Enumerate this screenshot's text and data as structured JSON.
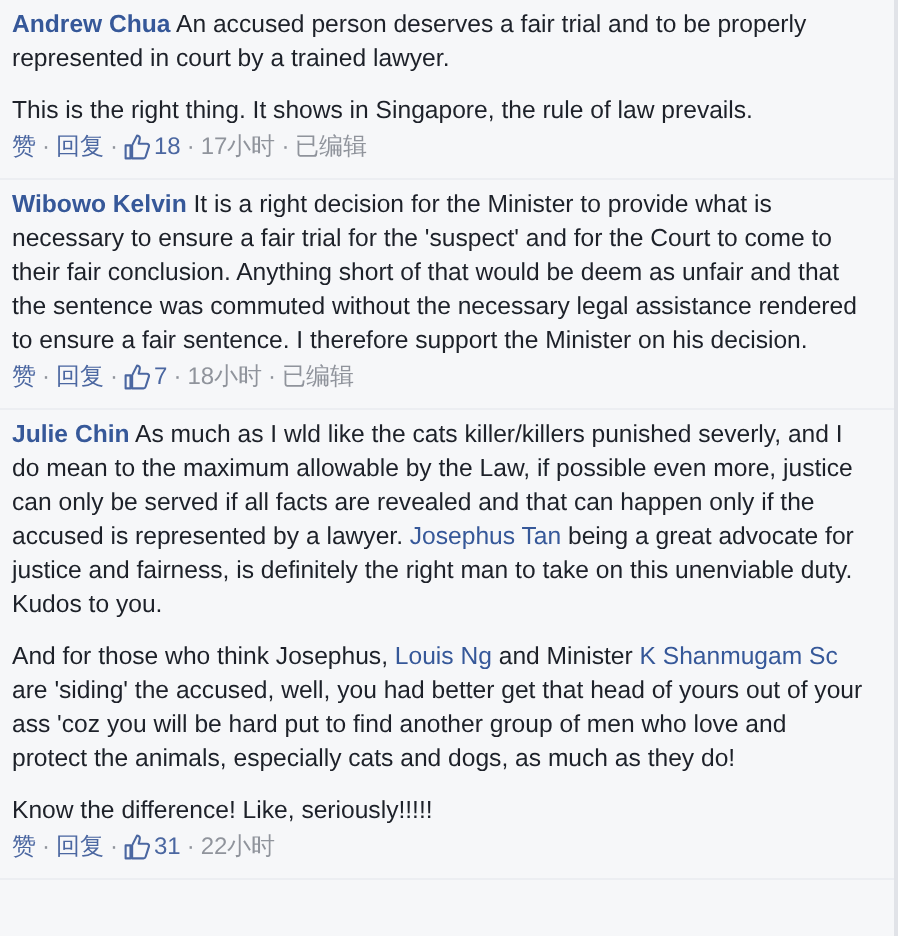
{
  "comments": [
    {
      "author": "Andrew Chua",
      "paragraphs": [
        [
          {
            "kind": "text",
            "text": "An accused person deserves a fair trial and to be properly represented in court by a trained lawyer."
          }
        ],
        [
          {
            "kind": "text",
            "text": "This is the right thing. It shows in Singapore, the rule of law prevails."
          }
        ]
      ],
      "footer": [
        {
          "kind": "like",
          "text": "赞"
        },
        {
          "kind": "separator",
          "text": "·"
        },
        {
          "kind": "reply",
          "text": "回复"
        },
        {
          "kind": "separator",
          "text": "·"
        },
        {
          "kind": "count",
          "text": "18"
        },
        {
          "kind": "separator",
          "text": "·"
        },
        {
          "kind": "time",
          "text": "17小时"
        },
        {
          "kind": "separator",
          "text": "·"
        },
        {
          "kind": "edited",
          "text": "已编辑"
        }
      ]
    },
    {
      "author": "Wibowo Kelvin",
      "paragraphs": [
        [
          {
            "kind": "text",
            "text": "It is a right decision for the Minister to provide what is necessary to ensure a fair trial for the 'suspect' and for the Court to come to their fair conclusion. Anything short of that would be deem as unfair and that the sentence was commuted without the necessary legal assistance rendered to ensure a fair sentence. I therefore support the Minister on his decision."
          }
        ]
      ],
      "footer": [
        {
          "kind": "like",
          "text": "赞"
        },
        {
          "kind": "separator",
          "text": "·"
        },
        {
          "kind": "reply",
          "text": "回复"
        },
        {
          "kind": "separator",
          "text": "·"
        },
        {
          "kind": "count",
          "text": "7"
        },
        {
          "kind": "separator",
          "text": "·"
        },
        {
          "kind": "time",
          "text": "18小时"
        },
        {
          "kind": "separator",
          "text": "·"
        },
        {
          "kind": "edited",
          "text": "已编辑"
        }
      ]
    },
    {
      "author": "Julie Chin",
      "paragraphs": [
        [
          {
            "kind": "text",
            "text": "As much as I wld like the cats killer/killers punished severly, and I do mean to the maximum allowable by the Law, if possible even more, justice can only be served if all facts are revealed and that can happen only if the accused is represented by a lawyer. "
          },
          {
            "kind": "mention",
            "text": "Josephus Tan"
          },
          {
            "kind": "text",
            "text": " being a great advocate for justice and fairness, is definitely the right man to take on this unenviable duty. Kudos to you."
          }
        ],
        [
          {
            "kind": "text",
            "text": "And for those who think Josephus, "
          },
          {
            "kind": "mention",
            "text": "Louis Ng"
          },
          {
            "kind": "text",
            "text": " and Minister "
          },
          {
            "kind": "mention",
            "text": "K Shanmugam Sc"
          },
          {
            "kind": "text",
            "text": " are 'siding' the accused, well, you had better get that head of yours out of your ass 'coz you will be hard put to find another group of men who love and protect the animals, especially cats and dogs, as much as they do!"
          }
        ],
        [
          {
            "kind": "text",
            "text": "Know the difference! Like, seriously!!!!!"
          }
        ]
      ],
      "footer": [
        {
          "kind": "like",
          "text": "赞"
        },
        {
          "kind": "separator",
          "text": "·"
        },
        {
          "kind": "reply",
          "text": "回复"
        },
        {
          "kind": "separator",
          "text": "·"
        },
        {
          "kind": "count",
          "text": "31"
        },
        {
          "kind": "separator",
          "text": "·"
        },
        {
          "kind": "time",
          "text": "22小时"
        }
      ]
    }
  ]
}
